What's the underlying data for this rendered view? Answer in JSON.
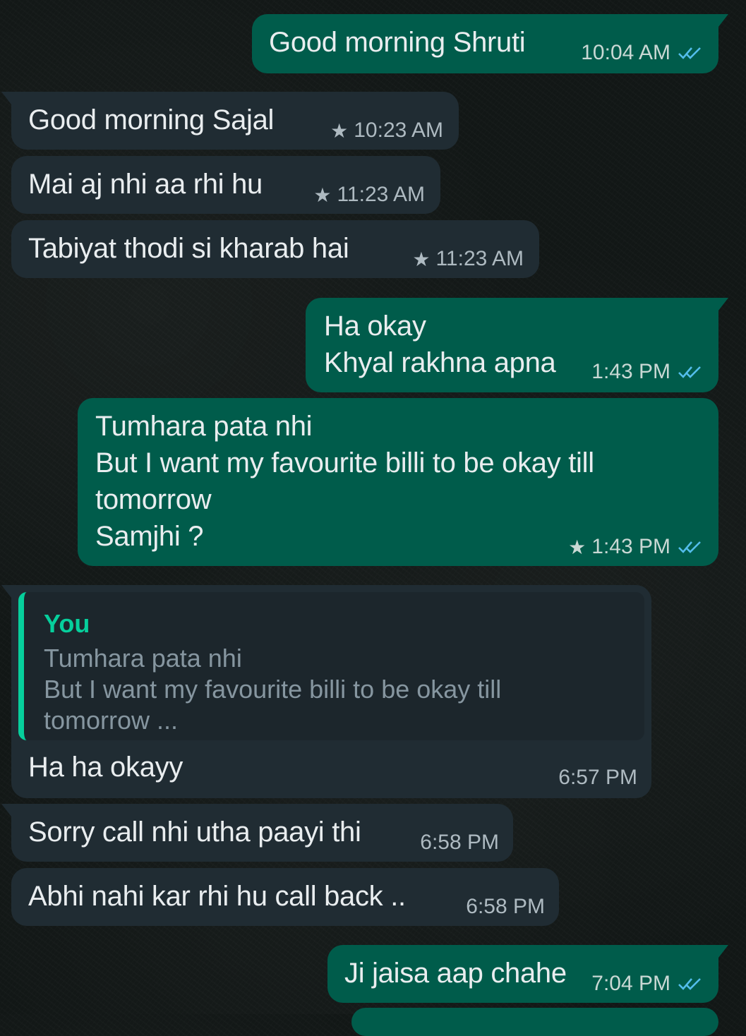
{
  "messages": [
    {
      "direction": "out",
      "text": "Good morning Shruti",
      "time": "10:04 AM",
      "starred": false,
      "status": "read"
    },
    {
      "direction": "in",
      "text": "Good morning Sajal",
      "time": "10:23 AM",
      "starred": true
    },
    {
      "direction": "in",
      "text": "Mai aj nhi aa rhi hu",
      "time": "11:23 AM",
      "starred": true
    },
    {
      "direction": "in",
      "text": "Tabiyat thodi si kharab hai",
      "time": "11:23 AM",
      "starred": true
    },
    {
      "direction": "out",
      "text": "Ha okay\nKhyal rakhna apna",
      "time": "1:43 PM",
      "starred": false,
      "status": "read"
    },
    {
      "direction": "out",
      "text": "Tumhara pata nhi\nBut I want my favourite billi to be okay till\ntomorrow\nSamjhi ?",
      "time": "1:43 PM",
      "starred": true,
      "status": "read"
    },
    {
      "direction": "in",
      "quoted": {
        "author": "You",
        "text": "Tumhara pata nhi\nBut I want my favourite billi to be okay till\ntomorrow ..."
      },
      "text": "Ha ha okayy",
      "time": "6:57 PM",
      "starred": false
    },
    {
      "direction": "in",
      "text": "Sorry call nhi utha paayi thi",
      "time": "6:58 PM",
      "starred": false
    },
    {
      "direction": "in",
      "text": "Abhi nahi kar rhi hu call back ..",
      "time": "6:58 PM",
      "starred": false
    },
    {
      "direction": "out",
      "text": "Ji jaisa aap chahe",
      "time": "7:04 PM",
      "starred": false,
      "status": "read"
    }
  ],
  "icons": {
    "star": "star-icon",
    "read_receipt": "double-check-icon"
  },
  "colors": {
    "incoming_bubble": "#202c33",
    "outgoing_bubble": "#005c4b",
    "quote_accent": "#06cf9c",
    "read_ticks": "#53bdeb"
  }
}
